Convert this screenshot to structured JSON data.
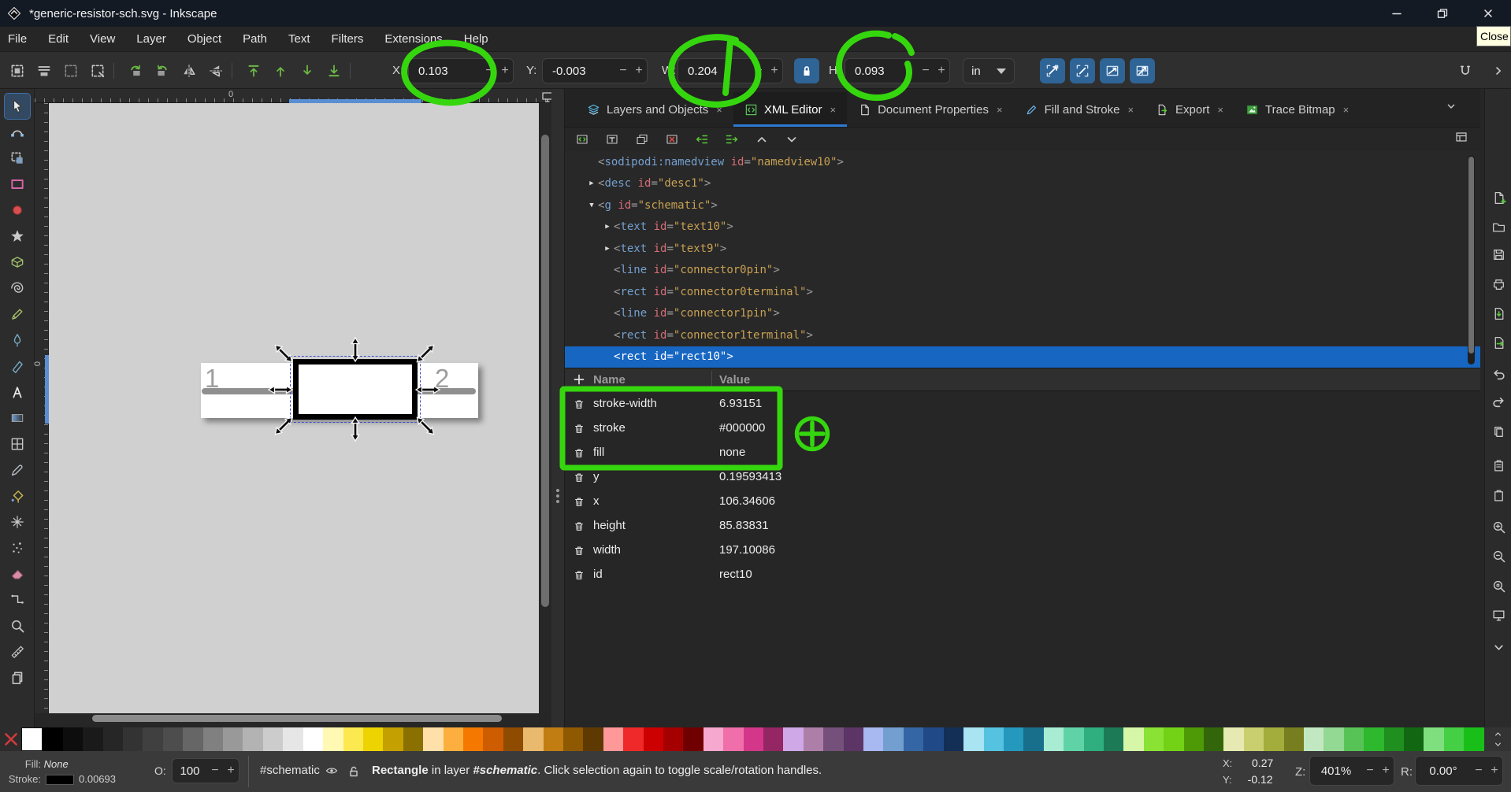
{
  "annotation_color": "#35d60e",
  "accent_color": "#2e7bd6",
  "ui": {
    "minus": "−",
    "plus": "+",
    "expander_collapsed": "▶",
    "expander_expanded": "▼"
  },
  "window": {
    "title": "*generic-resistor-sch.svg - Inkscape",
    "logo_icon": "inkscape-logo-icon",
    "control_icons": [
      "minimize-icon",
      "restore-icon",
      "close-icon"
    ],
    "tooltip_close": "Close"
  },
  "menubar": [
    "File",
    "Edit",
    "View",
    "Layer",
    "Object",
    "Path",
    "Text",
    "Filters",
    "Extensions",
    "Help"
  ],
  "command_toolbar": {
    "left_icons": [
      "select-all-icon",
      "select-all-layers-icon",
      "deselect-icon",
      "selection-box-icon",
      "rotate-ccw-icon",
      "rotate-cw-icon",
      "flip-horizontal-icon",
      "flip-vertical-icon",
      "raise-to-top-icon",
      "raise-icon",
      "lower-icon",
      "lower-to-bottom-icon"
    ],
    "x": {
      "label": "X:",
      "value": "0.103"
    },
    "y": {
      "label": "Y:",
      "value": "-0.003"
    },
    "w": {
      "label": "W:",
      "value": "0.204"
    },
    "h": {
      "label": "H:",
      "value": "0.093"
    },
    "lock_icon": "lock-closed-icon",
    "unit": "in",
    "scale_toggle_icons": [
      "scale-stroke-icon",
      "scale-corners-icon",
      "scale-gradient-icon",
      "scale-pattern-icon"
    ],
    "snap_icon": "snap-controls-icon",
    "snap_chevron_icon": "chevron-right-icon"
  },
  "toolbox": [
    "selector-tool-icon",
    "node-tool-icon",
    "shape-builder-tool-icon",
    "rect-tool-icon",
    "ellipse-tool-icon",
    "star-tool-icon",
    "box3d-tool-icon",
    "spiral-tool-icon",
    "pencil-tool-icon",
    "pen-tool-icon",
    "calligraphy-tool-icon",
    "text-tool-icon",
    "gradient-tool-icon",
    "mesh-tool-icon",
    "dropper-tool-icon",
    "bucket-tool-icon",
    "tweak-tool-icon",
    "spray-tool-icon",
    "eraser-tool-icon",
    "connector-tool-icon",
    "zoom-tool-icon",
    "measure-tool-icon",
    "pages-tool-icon"
  ],
  "rulers": {
    "zero_h": "0",
    "zero_v": "0",
    "corner_icon": "guide-lock-icon",
    "display_icon": "monitor-icon"
  },
  "canvas": {
    "label_1": "1",
    "label_2": "2"
  },
  "dock": {
    "tabs": [
      {
        "label": "Layers and Objects",
        "icon": "layers-tab-icon",
        "active": false
      },
      {
        "label": "XML Editor",
        "icon": "xml-tab-icon",
        "active": true
      },
      {
        "label": "Document Properties",
        "icon": "docprops-tab-icon",
        "active": false
      },
      {
        "label": "Fill and Stroke",
        "icon": "fillstroke-tab-icon",
        "active": false
      },
      {
        "label": "Export",
        "icon": "export-tab-icon",
        "active": false
      },
      {
        "label": "Trace Bitmap",
        "icon": "trace-tab-icon",
        "active": false
      }
    ],
    "close_glyph": "×",
    "xml_toolbar": [
      "new-element-node-icon",
      "new-text-node-icon",
      "duplicate-node-icon",
      "delete-node-icon",
      "unindent-node-icon",
      "indent-node-icon",
      "move-node-up-icon",
      "move-node-down-icon"
    ],
    "panel_icon": "panel-list-icon",
    "tree": [
      {
        "tag": "sodipodi:namedview",
        "attr": "id",
        "value": "namedview10",
        "indent": 0,
        "expander": "none",
        "selected": false
      },
      {
        "tag": "desc",
        "attr": "id",
        "value": "desc1",
        "indent": 0,
        "expander": "collapsed",
        "selected": false
      },
      {
        "tag": "g",
        "attr": "id",
        "value": "schematic",
        "indent": 0,
        "expander": "expanded",
        "selected": false
      },
      {
        "tag": "text",
        "attr": "id",
        "value": "text10",
        "indent": 1,
        "expander": "collapsed",
        "selected": false
      },
      {
        "tag": "text",
        "attr": "id",
        "value": "text9",
        "indent": 1,
        "expander": "collapsed",
        "selected": false
      },
      {
        "tag": "line",
        "attr": "id",
        "value": "connector0pin",
        "indent": 1,
        "expander": "none",
        "selected": false
      },
      {
        "tag": "rect",
        "attr": "id",
        "value": "connector0terminal",
        "indent": 1,
        "expander": "none",
        "selected": false
      },
      {
        "tag": "line",
        "attr": "id",
        "value": "connector1pin",
        "indent": 1,
        "expander": "none",
        "selected": false
      },
      {
        "tag": "rect",
        "attr": "id",
        "value": "connector1terminal",
        "indent": 1,
        "expander": "none",
        "selected": false
      },
      {
        "tag": "rect",
        "attr": "id",
        "value": "rect10",
        "indent": 1,
        "expander": "none",
        "selected": true
      }
    ],
    "attributes": {
      "add_icon": "plus-icon",
      "delete_icon": "trash-icon",
      "name_header": "Name",
      "value_header": "Value",
      "rows": [
        {
          "name": "stroke-width",
          "value": "6.93151"
        },
        {
          "name": "stroke",
          "value": "#000000"
        },
        {
          "name": "fill",
          "value": "none"
        },
        {
          "name": "y",
          "value": "0.19593413"
        },
        {
          "name": "x",
          "value": "106.34606"
        },
        {
          "name": "height",
          "value": "85.83831"
        },
        {
          "name": "width",
          "value": "197.10086"
        },
        {
          "name": "id",
          "value": "rect10"
        }
      ]
    }
  },
  "right_rail": [
    "document-new-icon",
    "document-open-icon",
    "document-save-icon",
    "document-print-icon",
    "import-icon",
    "export-icon",
    "undo-icon",
    "redo-icon",
    "copy-icon",
    "paste-icon",
    "clipboard-icon",
    "zoom-in-icon",
    "zoom-drawing-icon",
    "zoom-page-icon",
    "monitor-icon",
    "chevron-down-icon"
  ],
  "palette": {
    "none_icon": "none-color-icon",
    "scroll_icons": [
      "chevron-up-icon",
      "chevron-down-icon"
    ],
    "colors": [
      "#ffffff",
      "#000000",
      "#0d0d0d",
      "#1a1a1a",
      "#262626",
      "#333333",
      "#404040",
      "#4d4d4d",
      "#666666",
      "#808080",
      "#999999",
      "#b3b3b3",
      "#cccccc",
      "#e6e6e6",
      "#ffffff",
      "#fff9b3",
      "#fce94f",
      "#edd400",
      "#c4a000",
      "#8a7000",
      "#ffe0a8",
      "#fcaf3e",
      "#f57900",
      "#ce5c00",
      "#8f4b00",
      "#e9b96e",
      "#c17d11",
      "#8f5902",
      "#5e3a02",
      "#ff9999",
      "#ef2929",
      "#cc0000",
      "#a40000",
      "#700000",
      "#f7a8cf",
      "#f06eaa",
      "#d4368a",
      "#932663",
      "#cfa8e8",
      "#ad7fa8",
      "#75507b",
      "#5c3566",
      "#a8b8f0",
      "#729fcf",
      "#3465a4",
      "#204a87",
      "#142f56",
      "#a8e4f2",
      "#56c2e2",
      "#2598bd",
      "#186f8c",
      "#a8ecd3",
      "#5fd3a6",
      "#2fae7f",
      "#1d7a57",
      "#d7f7a8",
      "#8ae234",
      "#73d216",
      "#4e9a06",
      "#33660a",
      "#e6eab2",
      "#c9cf6f",
      "#a3ad3b",
      "#767e20",
      "#c2e8c2",
      "#93d893",
      "#57c357",
      "#2db82d",
      "#1f8f1f",
      "#126812",
      "#7fdf7f",
      "#44cf44",
      "#19bf19"
    ]
  },
  "statusbar": {
    "fill_label": "Fill:",
    "fill_value": "None",
    "stroke_label": "Stroke:",
    "stroke_value": "0.00693",
    "opacity_label": "O:",
    "opacity_value": "100",
    "layer_name": "#schematic",
    "visibility_icon": "eye-icon",
    "lock_icon": "lock-open-icon",
    "message_parts": [
      {
        "text": "Rectangle",
        "bold": true,
        "italic": false
      },
      {
        "text": " in layer ",
        "bold": false,
        "italic": false
      },
      {
        "text": "#schematic",
        "bold": true,
        "italic": true
      },
      {
        "text": ". Click selection again to toggle scale/rotation handles.",
        "bold": false,
        "italic": false
      }
    ],
    "x_label": "X:",
    "x_value": "0.27",
    "y_label": "Y:",
    "y_value": "-0.12",
    "zoom_label": "Z:",
    "zoom_value": "401%",
    "rotation_label": "R:",
    "rotation_value": "0.00°"
  }
}
